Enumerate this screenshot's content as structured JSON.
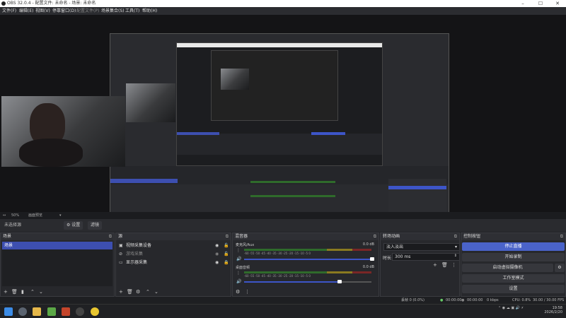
{
  "window": {
    "title": "OBS 32.0.4 - 配置文件: 未命名 - 场景: 未命名",
    "controls": {
      "min": "–",
      "max": "☐",
      "close": "✕"
    }
  },
  "menu": [
    "文件(F)",
    "编辑(E)",
    "视图(V)",
    "停靠窗口(D)",
    "配置文件(P)",
    "场景集合(S)",
    "工具(T)",
    "帮助(H)"
  ],
  "preview_controls": {
    "zoom": "50%",
    "mode": "画面预览"
  },
  "context_bar": {
    "label": "未选择源",
    "properties": "⚙ 设置",
    "filters": "滤镜"
  },
  "docks": {
    "scenes": {
      "title": "场景",
      "items": [
        "场景"
      ]
    },
    "sources": {
      "title": "源",
      "items": [
        {
          "icon": "camera-icon",
          "name": "视频采集设备"
        },
        {
          "icon": "eye-slash-icon",
          "name": "游戏采集"
        },
        {
          "icon": "monitor-icon",
          "name": "显示器采集"
        }
      ]
    },
    "mixer": {
      "title": "混音器",
      "channels": [
        {
          "name": "麦克风/Aux",
          "db": "0.0 dB",
          "volume": 1.0
        },
        {
          "name": "桌面音频",
          "db": "0.0 dB",
          "volume": 0.75
        }
      ],
      "ticks": [
        "-60",
        "-55",
        "-50",
        "-45",
        "-40",
        "-35",
        "-30",
        "-25",
        "-20",
        "-15",
        "-10",
        "-5",
        "0"
      ]
    },
    "transitions": {
      "title": "转场动画",
      "type": "淡入淡出",
      "duration_label": "时长",
      "duration": "300 ms"
    },
    "controls": {
      "title": "控制按钮",
      "buttons": [
        "停止直播",
        "开始录制",
        "启动虚拟摄像机",
        "工作室模式",
        "设置"
      ]
    }
  },
  "status": {
    "dropped": "丢帧 0 (0.0%)",
    "time1": "00:00:00",
    "time2": "00:00:00",
    "kbps": "0 kbps",
    "cpu": "CPU: 0.8%",
    "fps": "30.00 / 30.00 FPS"
  },
  "taskbar": {
    "time": "19:58",
    "date": "2026/2/20"
  }
}
